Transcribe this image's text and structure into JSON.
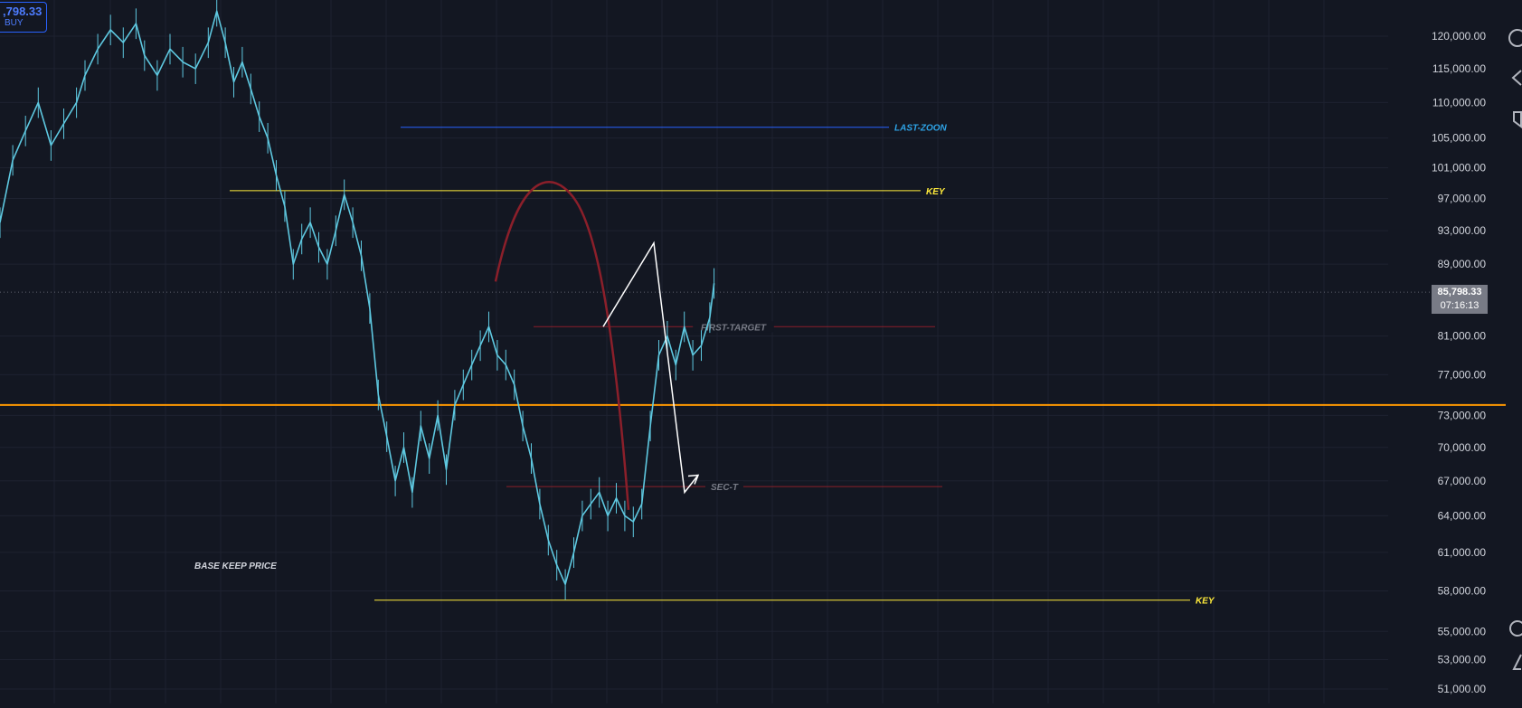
{
  "chart_data": {
    "type": "line",
    "title": "",
    "xlabel": "",
    "ylabel": "",
    "y_scale": "log",
    "ylim": [
      50000,
      125000
    ],
    "y_ticks": [
      120000,
      115000,
      110000,
      105000,
      101000,
      97000,
      93000,
      89000,
      81000,
      77000,
      73000,
      70000,
      67000,
      64000,
      61000,
      58000,
      55000,
      53000,
      51000
    ],
    "y_tick_labels": [
      "120,000.00",
      "115,000.00",
      "110,000.00",
      "105,000.00",
      "101,000.00",
      "97,000.00",
      "93,000.00",
      "89,000.00",
      "81,000.00",
      "77,000.00",
      "73,000.00",
      "70,000.00",
      "67,000.00",
      "64,000.00",
      "61,000.00",
      "58,000.00",
      "55,000.00",
      "53,000.00",
      "51,000.00"
    ],
    "x_index_range": [
      0,
      200
    ],
    "series": [
      {
        "color": "#5ec8e0",
        "points": [
          [
            0,
            94000
          ],
          [
            3,
            102000
          ],
          [
            6,
            106000
          ],
          [
            9,
            110000
          ],
          [
            12,
            104000
          ],
          [
            15,
            107000
          ],
          [
            18,
            110000
          ],
          [
            20,
            114000
          ],
          [
            23,
            118000
          ],
          [
            26,
            121000
          ],
          [
            29,
            119000
          ],
          [
            32,
            122000
          ],
          [
            34,
            117000
          ],
          [
            37,
            114000
          ],
          [
            40,
            118000
          ],
          [
            43,
            116000
          ],
          [
            46,
            115000
          ],
          [
            49,
            119000
          ],
          [
            51,
            124000
          ],
          [
            53,
            119000
          ],
          [
            55,
            113000
          ],
          [
            57,
            116000
          ],
          [
            59,
            112000
          ],
          [
            61,
            108000
          ],
          [
            63,
            105000
          ],
          [
            65,
            100000
          ],
          [
            67,
            96000
          ],
          [
            69,
            89000
          ],
          [
            71,
            92000
          ],
          [
            73,
            94000
          ],
          [
            75,
            91000
          ],
          [
            77,
            89000
          ],
          [
            79,
            93000
          ],
          [
            81,
            97500
          ],
          [
            83,
            94000
          ],
          [
            85,
            90000
          ],
          [
            87,
            84000
          ],
          [
            89,
            75000
          ],
          [
            91,
            71000
          ],
          [
            93,
            67000
          ],
          [
            95,
            70000
          ],
          [
            97,
            66000
          ],
          [
            99,
            72000
          ],
          [
            101,
            69000
          ],
          [
            103,
            73000
          ],
          [
            105,
            68000
          ],
          [
            107,
            74000
          ],
          [
            109,
            76000
          ],
          [
            111,
            78000
          ],
          [
            113,
            80000
          ],
          [
            115,
            82000
          ],
          [
            117,
            79000
          ],
          [
            119,
            78000
          ],
          [
            121,
            76000
          ],
          [
            123,
            72000
          ],
          [
            125,
            69000
          ],
          [
            127,
            65000
          ],
          [
            129,
            62000
          ],
          [
            131,
            60000
          ],
          [
            133,
            58500
          ],
          [
            135,
            61000
          ],
          [
            137,
            64000
          ],
          [
            139,
            65000
          ],
          [
            141,
            66000
          ],
          [
            143,
            64000
          ],
          [
            145,
            65500
          ],
          [
            147,
            64000
          ],
          [
            149,
            63500
          ],
          [
            151,
            65000
          ],
          [
            153,
            72000
          ],
          [
            155,
            79000
          ],
          [
            157,
            81000
          ],
          [
            159,
            78000
          ],
          [
            161,
            82000
          ],
          [
            163,
            79000
          ],
          [
            165,
            80000
          ],
          [
            167,
            83000
          ],
          [
            168,
            86800
          ]
        ]
      }
    ],
    "current_price": {
      "value": 85798.33,
      "label": "85,798.33",
      "countdown": "07:16:13"
    },
    "order_panel": {
      "price_label": ",798.33",
      "side_label": "BUY"
    },
    "horizontal_levels": [
      {
        "label": "LAST-ZOON",
        "value": 106500,
        "x_start": 146,
        "x_end": 327,
        "color": "#2962ff",
        "label_color": "#2ea3e6"
      },
      {
        "label": "KEY",
        "value": 98000,
        "x_start": 83,
        "x_end": 338,
        "color": "#ffeb3b",
        "label_color": "#ffeb3b"
      },
      {
        "label": "FIRST-TARGET",
        "value": 82000,
        "x_start": 195,
        "x_end": 344,
        "color": "#8b1f2a",
        "label_color": "#787b86"
      },
      {
        "label": "SEC-T",
        "value": 66500,
        "x_start": 185,
        "x_end": 346,
        "color": "#8b1f2a",
        "label_color": "#787b86"
      },
      {
        "label": "KEY",
        "value": 57300,
        "x_start": 137,
        "x_end": 436,
        "color": "#ffeb3b",
        "label_color": "#ffeb3b"
      }
    ],
    "rectangle": {
      "top_value": 74000,
      "x_start": 0,
      "x_end": 335,
      "color": "#ff9800"
    },
    "annotations": [
      {
        "text": "BASE KEEP PRICE",
        "x": 83,
        "value": 60000,
        "color": "#d1d4dc"
      }
    ],
    "arc": {
      "points": [
        [
          181,
          87000
        ],
        [
          201,
          94500
        ],
        [
          220,
          80000
        ],
        [
          230,
          64500
        ]
      ],
      "color": "#8b1f2a"
    },
    "arrow_path": {
      "points": [
        [
          221,
          82000
        ],
        [
          239,
          91500
        ],
        [
          250,
          66000
        ],
        [
          255,
          67500
        ]
      ],
      "color": "#ffffff"
    }
  }
}
